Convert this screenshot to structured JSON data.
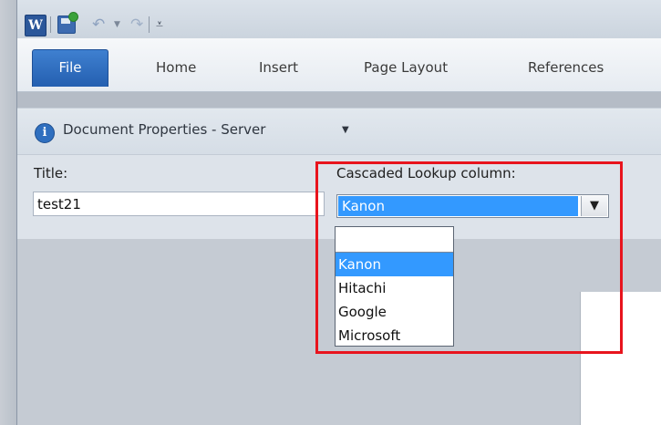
{
  "quick_access": {
    "app_icon": "word-app-icon",
    "save_icon": "save-icon",
    "undo_icon": "undo-icon",
    "redo_icon": "redo-icon",
    "customize_icon": "customize-toolbar-icon"
  },
  "ribbon": {
    "tabs": [
      {
        "label": "File"
      },
      {
        "label": "Home"
      },
      {
        "label": "Insert"
      },
      {
        "label": "Page Layout"
      },
      {
        "label": "References"
      }
    ]
  },
  "panel": {
    "title": "Document Properties - Server",
    "icon": "info-icon"
  },
  "fields": {
    "title_label": "Title:",
    "title_value": "test21",
    "cascade_label": "Cascaded Lookup column:",
    "cascade_value": "Kanon"
  },
  "dropdown": {
    "options": [
      "",
      "Kanon",
      "Hitachi",
      "Google",
      "Microsoft"
    ],
    "selected": "Kanon"
  },
  "colors": {
    "accent_blue": "#3399ff",
    "file_tab": "#2b6cc4",
    "highlight_red": "#e8141d"
  }
}
